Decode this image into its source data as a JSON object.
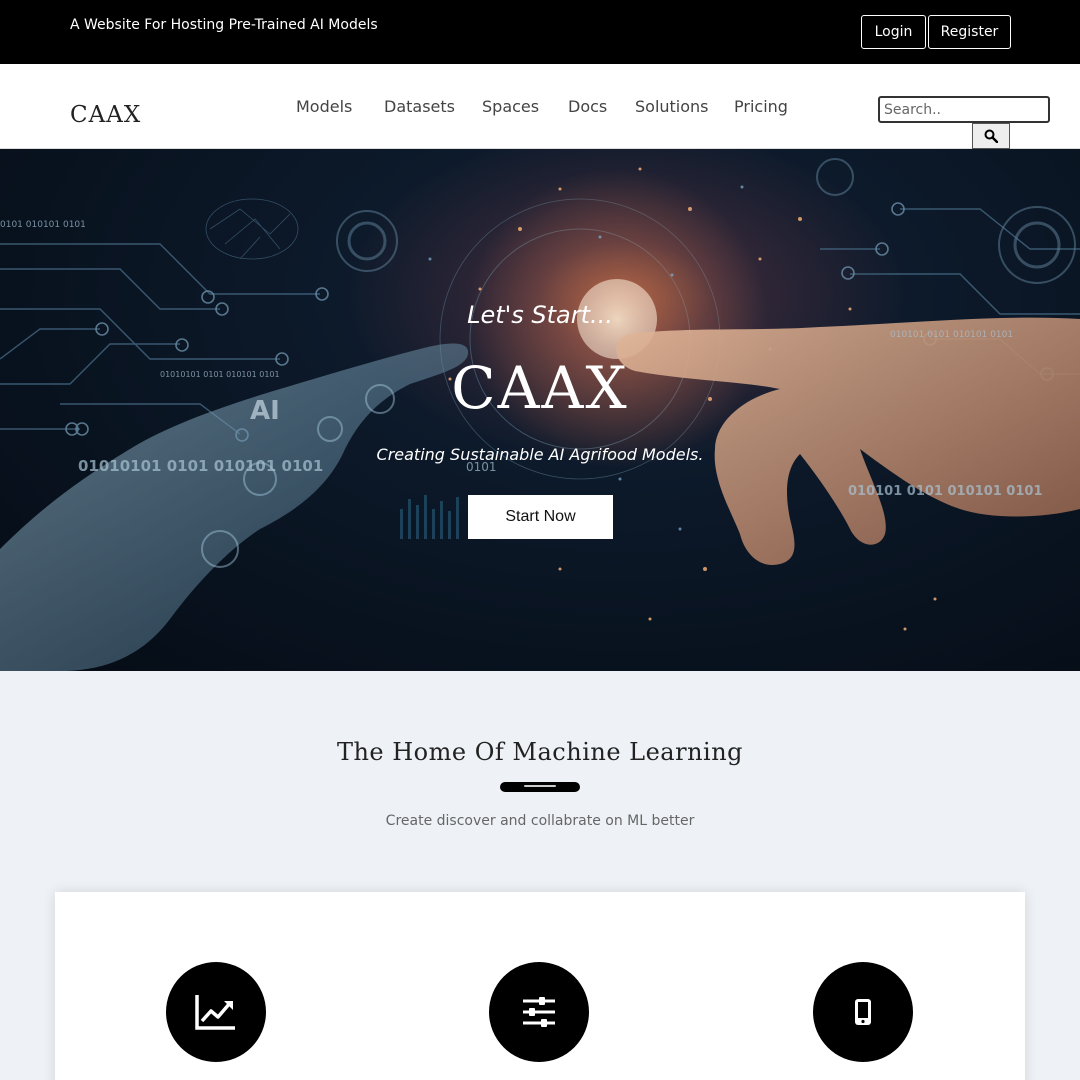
{
  "topbar": {
    "tagline": "A Website For Hosting Pre-Trained AI Models",
    "login_label": "Login",
    "register_label": "Register"
  },
  "nav": {
    "logo": "CAAX",
    "items": [
      {
        "label": "Models"
      },
      {
        "label": "Datasets"
      },
      {
        "label": "Spaces"
      },
      {
        "label": "Docs"
      },
      {
        "label": "Solutions"
      },
      {
        "label": "Pricing"
      }
    ],
    "search": {
      "placeholder": "Search.."
    },
    "search_icon": "search-icon"
  },
  "hero": {
    "kicker": "Let's Start...",
    "title": "CAAX",
    "subtitle": "Creating Sustainable AI Agrifood Models.",
    "cta_label": "Start Now",
    "decor_text": {
      "ai": "AI",
      "binary_a": "01010101 0101 010101 0101",
      "binary_b": "01010101 0101 010101 0101",
      "binary_c": "010101 0101 010101 0101",
      "binary_d": "0101 010101 0101",
      "binary_e": "0101"
    }
  },
  "section": {
    "title": "The Home Of Machine Learning",
    "subtitle": "Create discover and collabrate on ML better"
  },
  "features": [
    {
      "icon": "line-chart-icon"
    },
    {
      "icon": "sliders-icon"
    },
    {
      "icon": "mobile-phone-icon"
    }
  ],
  "colors": {
    "topbar_bg": "#000000",
    "page_bg": "#eef2f6",
    "accent": "#000000"
  }
}
